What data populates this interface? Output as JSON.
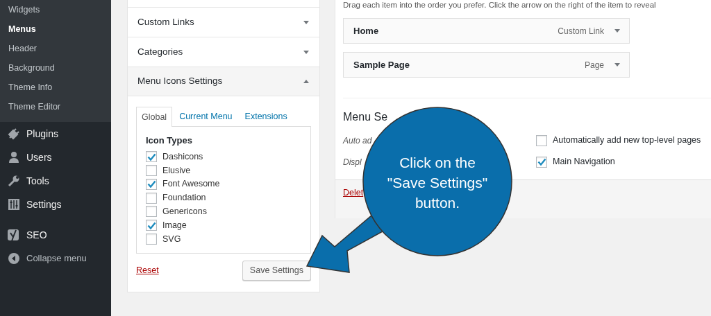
{
  "sidebar": {
    "submenu": [
      {
        "label": "Widgets",
        "selected": false
      },
      {
        "label": "Menus",
        "selected": true
      },
      {
        "label": "Header",
        "selected": false
      },
      {
        "label": "Background",
        "selected": false
      },
      {
        "label": "Theme Info",
        "selected": false
      },
      {
        "label": "Theme Editor",
        "selected": false
      }
    ],
    "menu": [
      {
        "label": "Plugins",
        "kind": "plugin"
      },
      {
        "label": "Users",
        "kind": "user"
      },
      {
        "label": "Tools",
        "kind": "wrench"
      },
      {
        "label": "Settings",
        "kind": "sliders"
      },
      {
        "label": "SEO",
        "kind": "seo"
      },
      {
        "label": "Collapse menu",
        "kind": "collapse"
      }
    ]
  },
  "left_panel": {
    "sections": [
      {
        "title": "Custom Links",
        "expanded": false
      },
      {
        "title": "Categories",
        "expanded": false
      },
      {
        "title": "Menu Icons Settings",
        "expanded": true
      }
    ],
    "tabs": [
      {
        "label": "Global",
        "selected": true
      },
      {
        "label": "Current Menu",
        "selected": false
      },
      {
        "label": "Extensions",
        "selected": false
      }
    ],
    "group_title": "Icon Types",
    "icon_types": [
      {
        "label": "Dashicons",
        "checked": true
      },
      {
        "label": "Elusive",
        "checked": false
      },
      {
        "label": "Font Awesome",
        "checked": true
      },
      {
        "label": "Foundation",
        "checked": false
      },
      {
        "label": "Genericons",
        "checked": false
      },
      {
        "label": "Image",
        "checked": true
      },
      {
        "label": "SVG",
        "checked": false
      }
    ],
    "reset_link": "Reset",
    "save_button": "Save Settings"
  },
  "right_panel": {
    "instructions": "Drag each item into the order you prefer. Click the arrow on the right of the item to reveal",
    "menu_items": [
      {
        "title": "Home",
        "type": "Custom Link"
      },
      {
        "title": "Sample Page",
        "type": "Page"
      }
    ],
    "settings_heading": "Menu Se",
    "settings_rows": [
      {
        "label": "Auto ad",
        "option": "Automatically add new top-level pages",
        "checked": false
      },
      {
        "label": "Displ",
        "option": "Main Navigation",
        "checked": true
      }
    ],
    "delete_link": "Delet"
  },
  "callout": {
    "lines": [
      "Click on the",
      "\"Save Settings\"",
      "button."
    ]
  }
}
